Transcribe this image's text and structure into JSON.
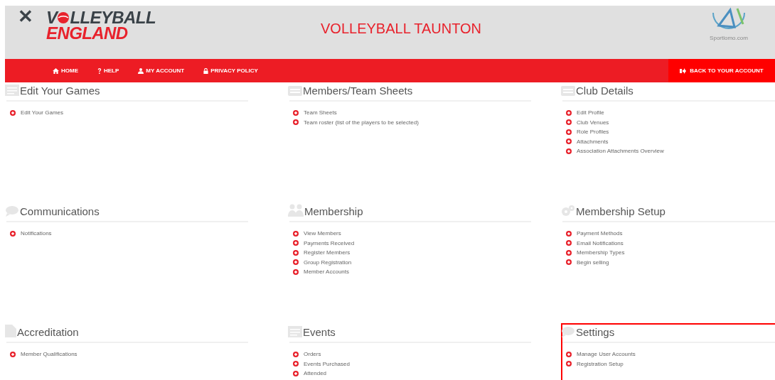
{
  "header": {
    "close": "✕",
    "logo": {
      "start": "V",
      "end": "LLEYBALL",
      "line2": "ENGLAND"
    },
    "title": "VOLLEYBALL TAUNTON",
    "partner": "Sportlomo.com"
  },
  "nav": {
    "items": [
      {
        "kind": "home",
        "label": "HOME"
      },
      {
        "kind": "help",
        "label": "HELP"
      },
      {
        "kind": "user",
        "label": "MY ACCOUNT"
      },
      {
        "kind": "lock",
        "label": "PRIVACY POLICY"
      }
    ],
    "back": "BACK TO YOUR ACCOUNT"
  },
  "sections": [
    {
      "title": "Edit Your Games",
      "kind": "list",
      "highlighted": false,
      "links": [
        "Edit Your Games"
      ]
    },
    {
      "title": "Members/Team Sheets",
      "kind": "keyboard",
      "highlighted": false,
      "links": [
        "Team Sheets",
        "Team roster (list of the players to be selected)"
      ]
    },
    {
      "title": "Club Details",
      "kind": "keyboard",
      "highlighted": false,
      "links": [
        "Edit Profile",
        "Club Venues",
        "Role Profiles",
        "Attachments",
        "Association Attachments Overview"
      ]
    },
    {
      "title": "Communications",
      "kind": "chat",
      "highlighted": false,
      "links": [
        "Notifications"
      ]
    },
    {
      "title": "Membership",
      "kind": "people",
      "highlighted": false,
      "links": [
        "View Members",
        "Payments Received",
        "Register Members",
        "Group Registration",
        "Member Accounts"
      ]
    },
    {
      "title": "Membership Setup",
      "kind": "gears",
      "highlighted": false,
      "links": [
        "Payment Methods",
        "Email Notifications",
        "Membership Types",
        "Begin selling"
      ]
    },
    {
      "title": "Accreditation",
      "kind": "file",
      "highlighted": false,
      "links": [
        "Member Qualifications"
      ]
    },
    {
      "title": "Events",
      "kind": "list",
      "highlighted": false,
      "links": [
        "Orders",
        "Events Purchased",
        "Attended"
      ]
    },
    {
      "title": "Settings",
      "kind": "chat",
      "highlighted": true,
      "links": [
        "Manage User Accounts",
        "Registration Setup"
      ]
    }
  ]
}
